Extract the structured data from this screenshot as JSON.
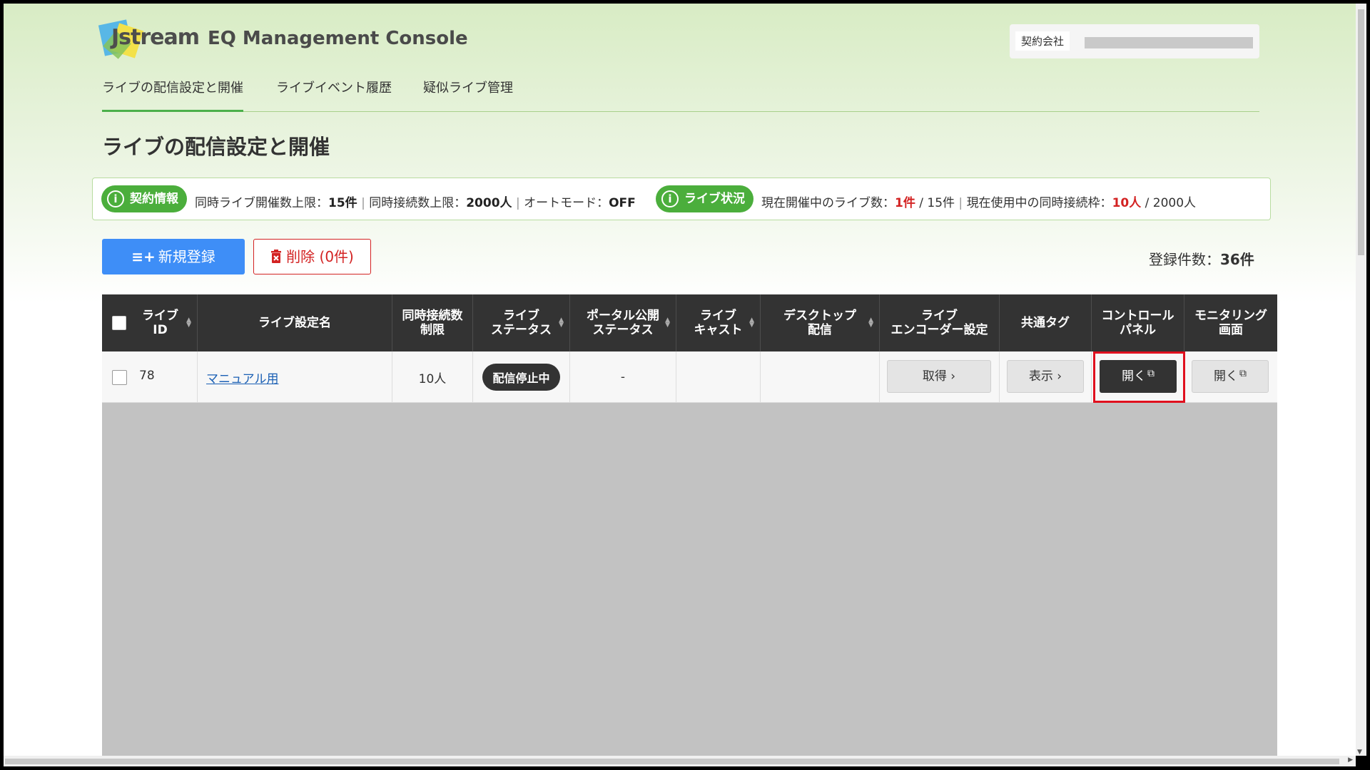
{
  "app": {
    "logo_text": "Jstream",
    "title": "EQ Management Console",
    "contract_label": "契約会社"
  },
  "nav": {
    "items": [
      {
        "label": "ライブの配信設定と開催",
        "active": true
      },
      {
        "label": "ライブイベント履歴",
        "active": false
      },
      {
        "label": "疑似ライブ管理",
        "active": false
      }
    ]
  },
  "page": {
    "title": "ライブの配信設定と開催"
  },
  "info": {
    "contract_pill": "契約情報",
    "max_live_label": "同時ライブ開催数上限：",
    "max_live_value": "15件",
    "sep1": "|",
    "max_conn_label": "同時接続数上限：",
    "max_conn_value": "2000人",
    "sep2": "|",
    "auto_mode_label": "オートモード：",
    "auto_mode_value": "OFF",
    "status_pill": "ライブ状況",
    "current_live_label": "現在開催中のライブ数：",
    "current_live_value": "1件",
    "current_live_total": "/ 15件",
    "sep3": "|",
    "current_conn_label": "現在使用中の同時接続枠：",
    "current_conn_value": "10人",
    "current_conn_total": "/ 2000人"
  },
  "actions": {
    "new_icon": "≡+",
    "new_label": "新規登録",
    "delete_label": "削除 (0件)",
    "count_label": "登録件数：",
    "count_value": "36件"
  },
  "table": {
    "headers": {
      "live_id": [
        "ライブ",
        "ID"
      ],
      "name": "ライブ設定名",
      "conn_limit": [
        "同時接続数",
        "制限"
      ],
      "live_status": [
        "ライブ",
        "ステータス"
      ],
      "portal_status": [
        "ポータル公開",
        "ステータス"
      ],
      "live_cast": [
        "ライブ",
        "キャスト"
      ],
      "desktop": [
        "デスクトップ",
        "配信"
      ],
      "encoder": [
        "ライブ",
        "エンコーダー設定"
      ],
      "common_tag": "共通タグ",
      "control_panel": [
        "コントロール",
        "パネル"
      ],
      "monitoring": [
        "モニタリング",
        "画面"
      ]
    },
    "rows": [
      {
        "id": "78",
        "name": "マニュアル用",
        "conn_limit": "10人",
        "live_status": "配信停止中",
        "portal_status": "-",
        "encoder_btn": "取得 ›",
        "tag_btn": "表示 ›",
        "control_btn": "開く",
        "monitor_btn": "開く"
      }
    ]
  },
  "colors": {
    "accent_green": "#4bae3c",
    "primary_blue": "#3e8ef7",
    "danger_red": "#d32222",
    "table_header": "#333333",
    "highlight": "#e0101e"
  }
}
